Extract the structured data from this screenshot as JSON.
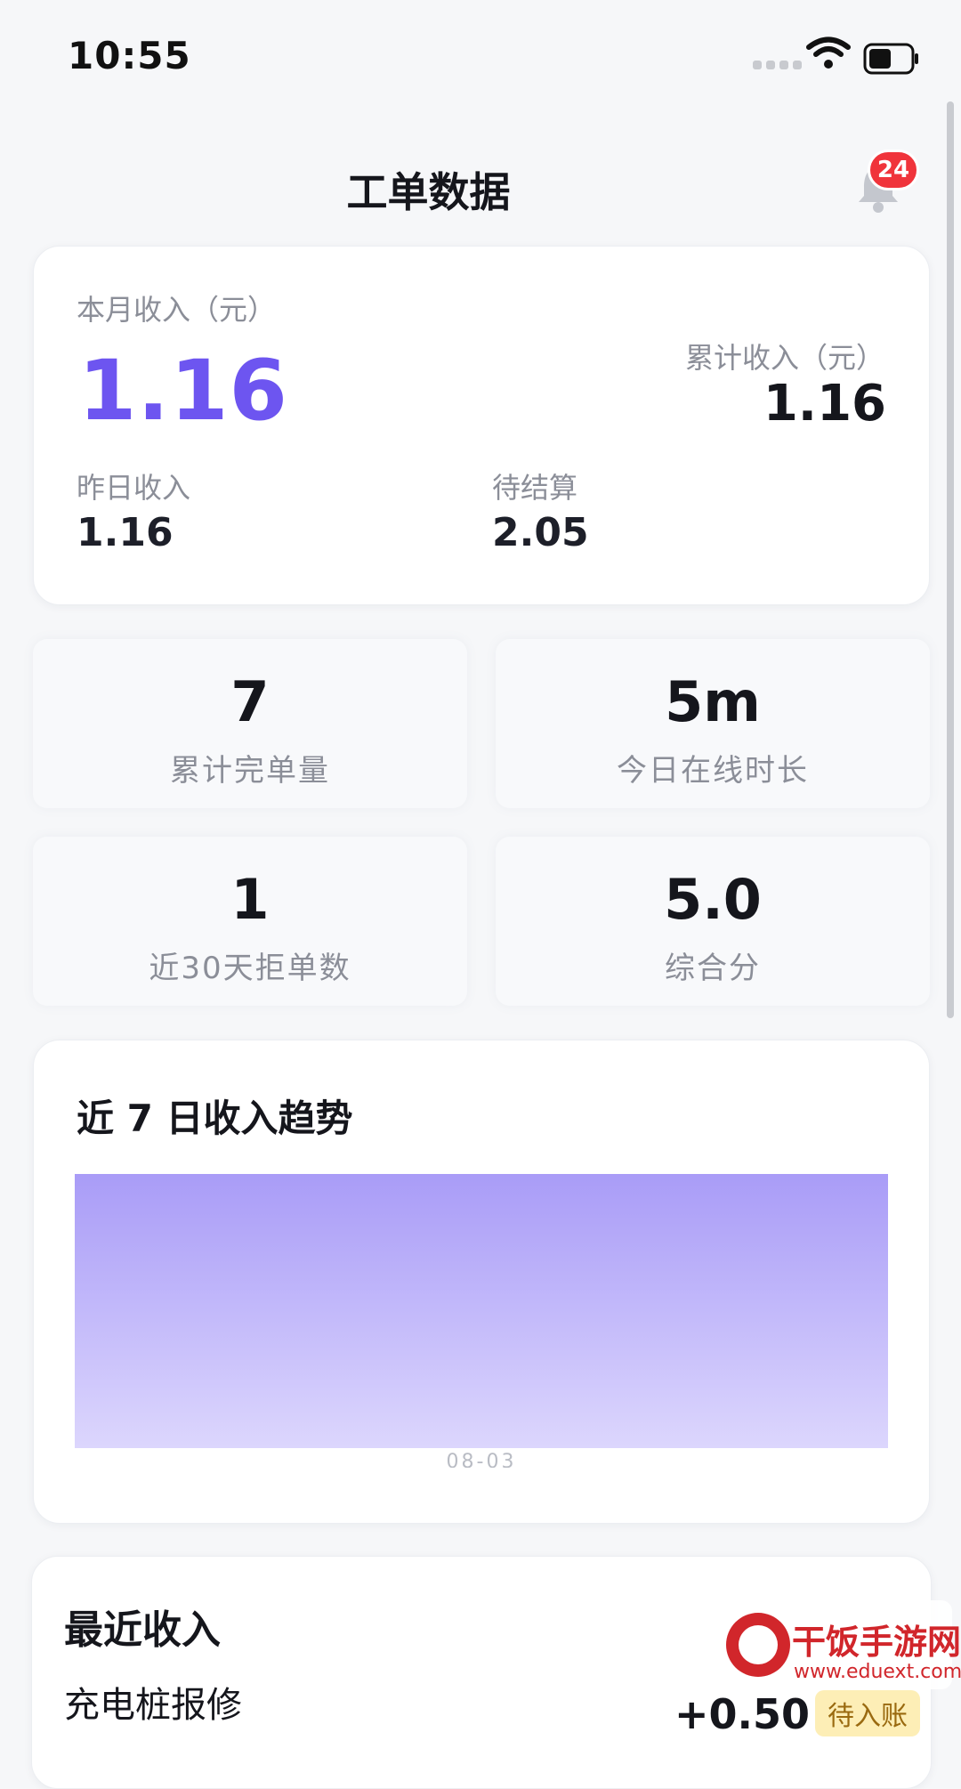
{
  "status_bar": {
    "time": "10:55",
    "icons": [
      "signal-icon",
      "wifi-icon",
      "battery-icon"
    ]
  },
  "header": {
    "title": "工单数据",
    "notification_count": "24"
  },
  "income": {
    "month_label": "本月收入（元）",
    "month_value": "1.16",
    "total_label": "累计收入（元）",
    "total_value": "1.16",
    "yesterday_label": "昨日收入",
    "yesterday_value": "1.16",
    "pending_label": "待结算",
    "pending_value": "2.05"
  },
  "stats": [
    {
      "value": "7",
      "label": "累计完单量"
    },
    {
      "value": "5m",
      "label": "今日在线时长"
    },
    {
      "value": "1",
      "label": "近30天拒单数"
    },
    {
      "value": "5.0",
      "label": "综合分"
    }
  ],
  "trend": {
    "title": "近 7 日收入趋势"
  },
  "chart_data": {
    "type": "area",
    "title": "近 7 日收入趋势",
    "x": [
      "08-03"
    ],
    "series": [
      {
        "values": [
          1.16
        ]
      }
    ],
    "tick_labels": [
      "08-03"
    ],
    "grid": false
  },
  "recent": {
    "title": "最近收入",
    "items": [
      {
        "name": "充电桩报修",
        "amount": "+0.50",
        "status": "待入账"
      }
    ]
  },
  "watermark": {
    "text": "干饭手游网",
    "url": "www.eduext.com"
  },
  "colors": {
    "accent": "#6d55f0",
    "badge": "#f0343b",
    "chart_top": "#a99cf7",
    "chart_bottom": "#dcd6fd"
  }
}
